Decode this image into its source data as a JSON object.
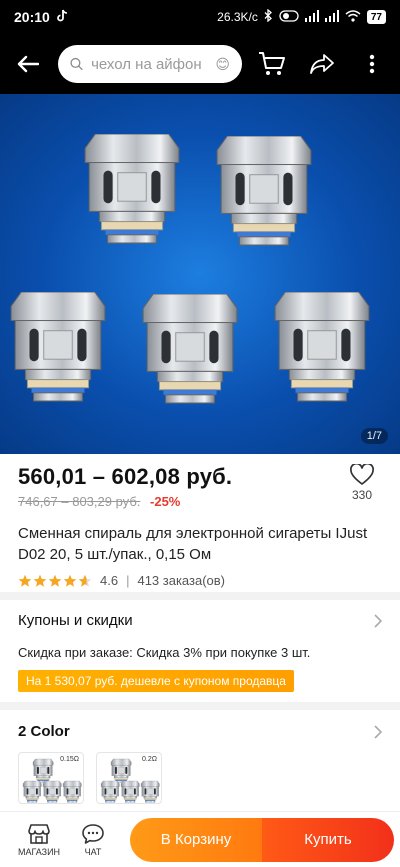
{
  "status_bar": {
    "time": "20:10",
    "network_speed": "26.3K/c",
    "battery": "77"
  },
  "top_bar": {
    "search_placeholder": "чехол на айфон"
  },
  "gallery": {
    "page_indicator": "1/7",
    "background_color": "#0a4fae"
  },
  "product": {
    "price_range": "560,01 – 602,08 руб.",
    "old_price": "746,67 – 803,29 руб.",
    "discount": "-25%",
    "wishlist_count": "330",
    "title": "Сменная спираль для электронной сигареты IJust D02 20, 5 шт./упак., 0,15 Ом",
    "rating_value": "4.6",
    "rating": 4.6,
    "orders": "413 заказа(ов)"
  },
  "coupons": {
    "heading": "Купоны и скидки",
    "discount_text": "Скидка при заказе: Скидка 3% при покупке 3 шт.",
    "banner_text": "На 1 530,07 руб. дешевле с купоном продавца",
    "banner_color": "#ffa800"
  },
  "color_section": {
    "heading": "2 Color",
    "options": [
      {
        "label": "0.15Ω"
      },
      {
        "label": "0.2Ω"
      }
    ]
  },
  "bottom_bar": {
    "store_label": "МАГАЗИН",
    "chat_label": "ЧАТ",
    "cart_button": "В Корзину",
    "buy_button": "Купить",
    "accent_orange": "#ff8a12",
    "accent_red": "#f2301a"
  }
}
